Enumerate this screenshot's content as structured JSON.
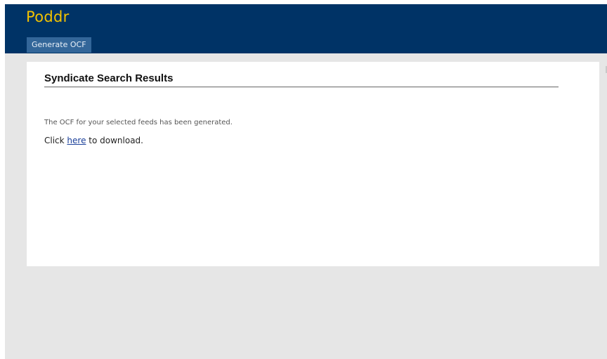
{
  "header": {
    "logo": "Poddr",
    "nav_label": "Generate OCF"
  },
  "content": {
    "title": "Syndicate Search Results",
    "message": "The OCF for your selected feeds has been generated.",
    "download_prefix": "Click ",
    "download_link": "here",
    "download_suffix": " to download."
  },
  "colors": {
    "header_bg": "#003366",
    "logo": "#f2c200",
    "nav_bg": "#336699",
    "page_bg": "#e6e6e6",
    "link": "#1a3f99"
  }
}
